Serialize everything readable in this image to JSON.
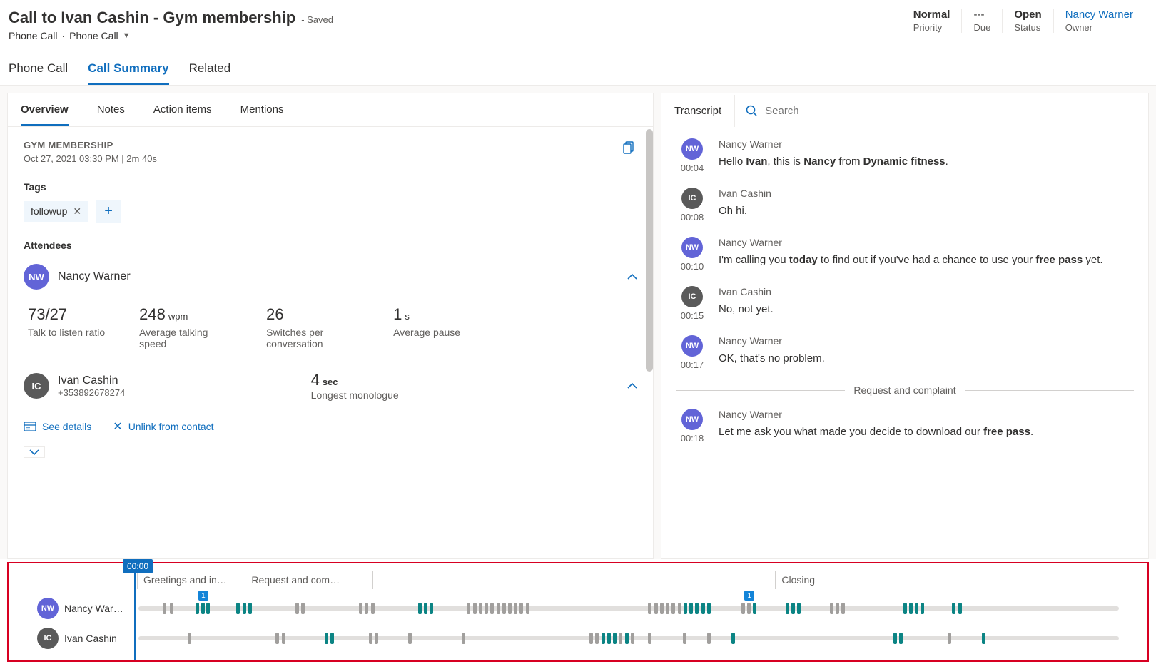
{
  "header": {
    "title": "Call to Ivan Cashin - Gym membership",
    "saved": "- Saved",
    "subtitle_a": "Phone Call",
    "subtitle_b": "Phone Call",
    "cols": [
      {
        "value": "Normal",
        "label": "Priority",
        "bold": true
      },
      {
        "value": "---",
        "label": "Due"
      },
      {
        "value": "Open",
        "label": "Status",
        "bold": true
      },
      {
        "value": "Nancy Warner",
        "label": "Owner",
        "link": true
      }
    ]
  },
  "toptabs": [
    "Phone Call",
    "Call Summary",
    "Related"
  ],
  "toptabs_active": 1,
  "subtabs": [
    "Overview",
    "Notes",
    "Action items",
    "Mentions"
  ],
  "subtabs_active": 0,
  "overview": {
    "heading": "GYM MEMBERSHIP",
    "meta": "Oct 27, 2021 03:30 PM  |  2m 40s",
    "tags_label": "Tags",
    "tags": [
      "followup"
    ],
    "attendees_label": "Attendees",
    "nw": {
      "initials": "NW",
      "name": "Nancy Warner",
      "stats": [
        {
          "val": "73/27",
          "unit": "",
          "label": "Talk to listen ratio"
        },
        {
          "val": "248",
          "unit": "wpm",
          "label": "Average talking speed"
        },
        {
          "val": "26",
          "unit": "",
          "label": "Switches per conversation"
        },
        {
          "val": "1",
          "unit": "s",
          "label": "Average pause"
        }
      ]
    },
    "ic": {
      "initials": "IC",
      "name": "Ivan Cashin",
      "phone": "+353892678274",
      "mono_val": "4",
      "mono_unit": "sec",
      "mono_label": "Longest monologue"
    },
    "see_details": "See details",
    "unlink": "Unlink from contact"
  },
  "right": {
    "title": "Transcript",
    "search_placeholder": "Search"
  },
  "transcript": [
    {
      "speaker": "Nancy Warner",
      "initials": "NW",
      "cls": "nw",
      "time": "00:04",
      "html": "Hello <b>Ivan</b>, this is <b>Nancy</b> from <b>Dynamic fitness</b>."
    },
    {
      "speaker": "Ivan Cashin",
      "initials": "IC",
      "cls": "ic",
      "time": "00:08",
      "html": "Oh hi."
    },
    {
      "speaker": "Nancy Warner",
      "initials": "NW",
      "cls": "nw",
      "time": "00:10",
      "html": "I'm calling you <b>today</b> to find out if you've had a chance to use your <b>free pass</b> yet."
    },
    {
      "speaker": "Ivan Cashin",
      "initials": "IC",
      "cls": "ic",
      "time": "00:15",
      "html": "No, not yet."
    },
    {
      "speaker": "Nancy Warner",
      "initials": "NW",
      "cls": "nw",
      "time": "00:17",
      "html": "OK, that's no problem."
    },
    {
      "divider": "Request and complaint"
    },
    {
      "speaker": "Nancy Warner",
      "initials": "NW",
      "cls": "nw",
      "time": "00:18",
      "html": "Let me ask you what made you decide to download our <b>free pass</b>."
    }
  ],
  "timeline": {
    "playhead": "00:00",
    "segments": [
      {
        "label": "Greetings and in…",
        "width": 11
      },
      {
        "label": "Request and com…",
        "width": 13
      },
      {
        "label": "",
        "width": 41
      },
      {
        "label": "Closing",
        "width": 35
      }
    ],
    "tracks": [
      {
        "speaker": "Nancy War…",
        "initials": "NW",
        "cls": "nw",
        "marks": [
          {
            "p": 2.5,
            "c": "gray"
          },
          {
            "p": 3.2,
            "c": "gray"
          },
          {
            "p": 5.8,
            "c": "teal"
          },
          {
            "p": 6.4,
            "c": "teal",
            "badge": "1"
          },
          {
            "p": 6.9,
            "c": "teal"
          },
          {
            "p": 10.0,
            "c": "teal"
          },
          {
            "p": 10.6,
            "c": "teal"
          },
          {
            "p": 11.2,
            "c": "teal"
          },
          {
            "p": 16.0,
            "c": "gray"
          },
          {
            "p": 16.6,
            "c": "gray"
          },
          {
            "p": 22.5,
            "c": "gray"
          },
          {
            "p": 23.1,
            "c": "gray"
          },
          {
            "p": 23.7,
            "c": "gray"
          },
          {
            "p": 28.5,
            "c": "teal"
          },
          {
            "p": 29.1,
            "c": "teal"
          },
          {
            "p": 29.7,
            "c": "teal"
          },
          {
            "p": 33.5,
            "c": "gray"
          },
          {
            "p": 34.1,
            "c": "gray"
          },
          {
            "p": 34.7,
            "c": "gray"
          },
          {
            "p": 35.3,
            "c": "gray"
          },
          {
            "p": 35.9,
            "c": "gray"
          },
          {
            "p": 36.5,
            "c": "gray"
          },
          {
            "p": 37.1,
            "c": "gray"
          },
          {
            "p": 37.7,
            "c": "gray"
          },
          {
            "p": 38.3,
            "c": "gray"
          },
          {
            "p": 38.9,
            "c": "gray"
          },
          {
            "p": 39.5,
            "c": "gray"
          },
          {
            "p": 52.0,
            "c": "gray"
          },
          {
            "p": 52.6,
            "c": "gray"
          },
          {
            "p": 53.2,
            "c": "gray"
          },
          {
            "p": 53.8,
            "c": "gray"
          },
          {
            "p": 54.4,
            "c": "gray"
          },
          {
            "p": 55.0,
            "c": "gray"
          },
          {
            "p": 55.6,
            "c": "teal"
          },
          {
            "p": 56.2,
            "c": "teal"
          },
          {
            "p": 56.8,
            "c": "teal"
          },
          {
            "p": 57.4,
            "c": "teal"
          },
          {
            "p": 58.0,
            "c": "teal"
          },
          {
            "p": 61.5,
            "c": "gray"
          },
          {
            "p": 62.1,
            "c": "gray",
            "badge": "1"
          },
          {
            "p": 62.7,
            "c": "teal"
          },
          {
            "p": 66.0,
            "c": "teal"
          },
          {
            "p": 66.6,
            "c": "teal"
          },
          {
            "p": 67.2,
            "c": "teal"
          },
          {
            "p": 70.5,
            "c": "gray"
          },
          {
            "p": 71.1,
            "c": "gray"
          },
          {
            "p": 71.7,
            "c": "gray"
          },
          {
            "p": 78.0,
            "c": "teal"
          },
          {
            "p": 78.6,
            "c": "teal"
          },
          {
            "p": 79.2,
            "c": "teal"
          },
          {
            "p": 79.8,
            "c": "teal"
          },
          {
            "p": 83.0,
            "c": "teal"
          },
          {
            "p": 83.6,
            "c": "teal"
          }
        ]
      },
      {
        "speaker": "Ivan Cashin",
        "initials": "IC",
        "cls": "ic",
        "marks": [
          {
            "p": 5.0,
            "c": "gray"
          },
          {
            "p": 14.0,
            "c": "gray"
          },
          {
            "p": 14.6,
            "c": "gray"
          },
          {
            "p": 19.0,
            "c": "teal"
          },
          {
            "p": 19.6,
            "c": "teal"
          },
          {
            "p": 23.5,
            "c": "gray"
          },
          {
            "p": 24.1,
            "c": "gray"
          },
          {
            "p": 27.5,
            "c": "gray"
          },
          {
            "p": 33.0,
            "c": "gray"
          },
          {
            "p": 46.0,
            "c": "gray"
          },
          {
            "p": 46.6,
            "c": "gray"
          },
          {
            "p": 47.2,
            "c": "teal"
          },
          {
            "p": 47.8,
            "c": "teal"
          },
          {
            "p": 48.4,
            "c": "teal"
          },
          {
            "p": 49.0,
            "c": "gray"
          },
          {
            "p": 49.6,
            "c": "teal"
          },
          {
            "p": 50.2,
            "c": "gray"
          },
          {
            "p": 52.0,
            "c": "gray"
          },
          {
            "p": 55.5,
            "c": "gray"
          },
          {
            "p": 58.0,
            "c": "gray"
          },
          {
            "p": 60.5,
            "c": "teal"
          },
          {
            "p": 77.0,
            "c": "teal"
          },
          {
            "p": 77.6,
            "c": "teal"
          },
          {
            "p": 82.5,
            "c": "gray"
          },
          {
            "p": 86.0,
            "c": "teal"
          }
        ]
      }
    ]
  }
}
